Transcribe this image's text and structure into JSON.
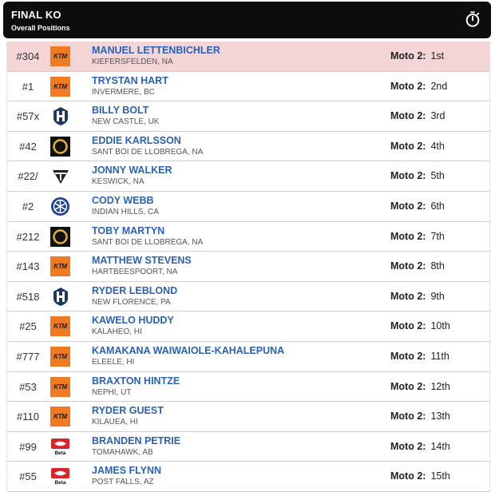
{
  "header": {
    "title": "FINAL KO",
    "subtitle": "Overall Positions",
    "timer_icon": "stopwatch-icon"
  },
  "colors": {
    "header_bg": "#0d0d0d",
    "highlight_row": "#f3d5d6",
    "rider_name": "#2b61b6",
    "ktm_orange": "#f07a22"
  },
  "riders": [
    {
      "number": "#304",
      "brand": "ktm",
      "name": "MANUEL LETTENBICHLER",
      "location": "KIEFERSFELDEN, NA",
      "moto_label": "Moto 2:",
      "position": "1st",
      "highlight": true
    },
    {
      "number": "#1",
      "brand": "ktm",
      "name": "TRYSTAN HART",
      "location": "INVERMERE, BC",
      "moto_label": "Moto 2:",
      "position": "2nd"
    },
    {
      "number": "#57x",
      "brand": "husqvarna",
      "name": "BILLY BOLT",
      "location": "NEW CASTLE, UK",
      "moto_label": "Moto 2:",
      "position": "3rd"
    },
    {
      "number": "#42",
      "brand": "tm-ring",
      "name": "EDDIE KARLSSON",
      "location": "SANT BOI DE LLOBREGA, NA",
      "moto_label": "Moto 2:",
      "position": "4th"
    },
    {
      "number": "#22/",
      "brand": "triumph",
      "name": "JONNY WALKER",
      "location": "KESWICK, NA",
      "moto_label": "Moto 2:",
      "position": "5th"
    },
    {
      "number": "#2",
      "brand": "yamaha",
      "name": "CODY WEBB",
      "location": "INDIAN HILLS, CA",
      "moto_label": "Moto 2:",
      "position": "6th"
    },
    {
      "number": "#212",
      "brand": "tm-ring",
      "name": "TOBY MARTYN",
      "location": "SANT BOI DE LLOBREGA, NA",
      "moto_label": "Moto 2:",
      "position": "7th"
    },
    {
      "number": "#143",
      "brand": "ktm",
      "name": "MATTHEW STEVENS",
      "location": "HARTBEESPOORT, NA",
      "moto_label": "Moto 2:",
      "position": "8th"
    },
    {
      "number": "#518",
      "brand": "husqvarna",
      "name": "RYDER LEBLOND",
      "location": "NEW FLORENCE, PA",
      "moto_label": "Moto 2:",
      "position": "9th"
    },
    {
      "number": "#25",
      "brand": "ktm",
      "name": "KAWELO HUDDY",
      "location": "KALAHEO, HI",
      "moto_label": "Moto 2:",
      "position": "10th"
    },
    {
      "number": "#777",
      "brand": "ktm",
      "name": "KAMAKANA WAIWAIOLE-KAHALEPUNA",
      "location": "ELEELE, HI",
      "moto_label": "Moto 2:",
      "position": "11th"
    },
    {
      "number": "#53",
      "brand": "ktm",
      "name": "BRAXTON HINTZE",
      "location": "NEPHI, UT",
      "moto_label": "Moto 2:",
      "position": "12th"
    },
    {
      "number": "#110",
      "brand": "ktm",
      "name": "RYDER GUEST",
      "location": "KILAUEA, HI",
      "moto_label": "Moto 2:",
      "position": "13th"
    },
    {
      "number": "#99",
      "brand": "beta",
      "name": "BRANDEN PETRIE",
      "location": "TOMAHAWK, AB",
      "moto_label": "Moto 2:",
      "position": "14th"
    },
    {
      "number": "#55",
      "brand": "beta",
      "name": "JAMES FLYNN",
      "location": "POST FALLS, AZ",
      "moto_label": "Moto 2:",
      "position": "15th"
    }
  ],
  "logo_text": {
    "ktm": "KTM",
    "beta": "Beta"
  }
}
